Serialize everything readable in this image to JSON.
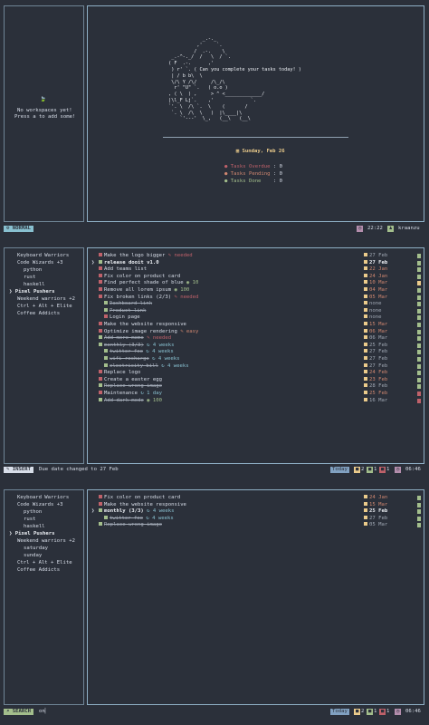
{
  "screen1": {
    "empty_icon": "🍃",
    "empty_line1": "No workspaces yet!",
    "empty_line2": "Press a to add some!",
    "ascii_art": "             _.-._\n           ,'     `.\n          /  .-.    \\\n  _.-^-._/  /   \\  / `.\n ( F  .-.      ,'\n  ) r' `. ( Can you complete your tasks today! )\n  | / b b\\  \\\n  \\/\\ Y /\\/     /\\_/\\\n   r' \"U\" `.   ( o.o )\n , ( \\  ) ,     > ^ <_____________/\n |\\l_F Lj`.    ,'             `.\n `'. \\  /\\ `.  \\    (       /\n  `. \\  /\\  \\   )  |\\____|\\\n     `'---'  \\_,   (__\\   (__\\",
    "speech": "( Can you complete your tasks today! )",
    "date": "Sunday, Feb 26",
    "stats": [
      {
        "label": "Tasks Overdue",
        "value": ": 0",
        "color": "#bf616a"
      },
      {
        "label": "Tasks Pending",
        "value": ": 0",
        "color": "#d08770"
      },
      {
        "label": "Tasks Done   ",
        "value": ": 0",
        "color": "#a3be8c"
      }
    ],
    "status": {
      "mode": "NORMAL",
      "time": "22:22",
      "user": "kraanzu"
    }
  },
  "screen2": {
    "workspaces": [
      {
        "label": "Keyboard Warriors",
        "indent": 0,
        "sel": false
      },
      {
        "label": "Code Wizards +3",
        "indent": 0,
        "sel": false
      },
      {
        "label": "python",
        "indent": 1,
        "sel": false
      },
      {
        "label": "rust",
        "indent": 1,
        "sel": false
      },
      {
        "label": "haskell",
        "indent": 1,
        "sel": false
      },
      {
        "label": "Pixel Pushers",
        "indent": 0,
        "sel": true
      },
      {
        "label": "Weekend warriors +2",
        "indent": 0,
        "sel": false
      },
      {
        "label": "Ctrl + Alt + Elite",
        "indent": 0,
        "sel": false
      },
      {
        "label": "Coffee Addicts",
        "indent": 0,
        "sel": false
      }
    ],
    "tasks": [
      {
        "text": "Make the logo bigger",
        "tag": "needed",
        "tc": "",
        "due": "27 Feb",
        "dc": "due-gray",
        "icon": "o",
        "st": "",
        "prio": "#a3be8c"
      },
      {
        "text": "release dooit v1.0",
        "tag": "",
        "tc": "",
        "due": "27 Feb",
        "dc": "due-strong",
        "icon": "g",
        "st": "bold",
        "prio": "#a3be8c"
      },
      {
        "text": "Add teams list",
        "tag": "",
        "tc": "",
        "due": "22 Jan",
        "dc": "due-red",
        "icon": "o",
        "st": "",
        "prio": "#a3be8c"
      },
      {
        "text": "Fix color on product card",
        "tag": "",
        "tc": "",
        "due": "24 Jan",
        "dc": "due-red",
        "icon": "o",
        "st": "",
        "prio": "#a3be8c"
      },
      {
        "text": "Find perfect shade of blue",
        "tag": "10",
        "tc": "b",
        "due": "10 Mar",
        "dc": "due-red",
        "icon": "o",
        "st": "",
        "prio": "#ebcb8b"
      },
      {
        "text": "Remove all lorem ipsum",
        "tag": "100",
        "tc": "b",
        "due": "04 Mar",
        "dc": "due-red",
        "icon": "o",
        "st": "",
        "prio": "#a3be8c"
      },
      {
        "text": "Fix broken links (2/3)",
        "tag": "needed",
        "tc": "",
        "due": "05 Mar",
        "dc": "due-red",
        "icon": "o",
        "st": "",
        "prio": "#a3be8c"
      },
      {
        "text": "  Dashboard link",
        "tag": "",
        "tc": "",
        "due": "none",
        "dc": "due-gray",
        "icon": "g",
        "st": "done",
        "prio": "#a3be8c"
      },
      {
        "text": "  Product link",
        "tag": "",
        "tc": "",
        "due": "none",
        "dc": "due-gray",
        "icon": "g",
        "st": "done",
        "prio": "#a3be8c"
      },
      {
        "text": "  Login page",
        "tag": "",
        "tc": "",
        "due": "none",
        "dc": "due-gray",
        "icon": "o",
        "st": "",
        "prio": "#a3be8c"
      },
      {
        "text": "Make the website responsive",
        "tag": "",
        "tc": "",
        "due": "15 Mar",
        "dc": "due-red",
        "icon": "o",
        "st": "",
        "prio": "#a3be8c"
      },
      {
        "text": "Optimize image rendering",
        "tag": "easy",
        "tc": "y",
        "due": "06 Mar",
        "dc": "due-red",
        "icon": "o",
        "st": "",
        "prio": "#a3be8c"
      },
      {
        "text": "Add more memo",
        "tag": "needed",
        "tc": "",
        "due": "06 Mar",
        "dc": "due-gray",
        "icon": "g",
        "st": "done",
        "prio": "#a3be8c"
      },
      {
        "text": "monthly (3/3)",
        "tag": "4 weeks",
        "tc": "g",
        "due": "25 Feb",
        "dc": "due-gray",
        "icon": "g",
        "st": "done",
        "prio": "#a3be8c"
      },
      {
        "text": "  twitter fee",
        "tag": "4 weeks",
        "tc": "g",
        "due": "27 Feb",
        "dc": "due-gray",
        "icon": "g",
        "st": "done",
        "prio": "#a3be8c"
      },
      {
        "text": "  wifi recharge",
        "tag": "4 weeks",
        "tc": "g",
        "due": "27 Feb",
        "dc": "due-gray",
        "icon": "g",
        "st": "done",
        "prio": "#a3be8c"
      },
      {
        "text": "  electricity bill",
        "tag": "4 weeks",
        "tc": "g",
        "due": "27 Feb",
        "dc": "due-gray",
        "icon": "g",
        "st": "done",
        "prio": "#a3be8c"
      },
      {
        "text": "Replace logo",
        "tag": "",
        "tc": "",
        "due": "24 Feb",
        "dc": "due-red",
        "icon": "o",
        "st": "",
        "prio": "#a3be8c"
      },
      {
        "text": "Create a easter egg",
        "tag": "",
        "tc": "",
        "due": "23 Feb",
        "dc": "due-red",
        "icon": "o",
        "st": "",
        "prio": "#a3be8c"
      },
      {
        "text": "Replace wrong image",
        "tag": "",
        "tc": "",
        "due": "28 Feb",
        "dc": "due-gray",
        "icon": "g",
        "st": "done",
        "prio": "#a3be8c"
      },
      {
        "text": "Maintenance",
        "tag": "1 day",
        "tc": "g",
        "due": "25 Feb",
        "dc": "due-red",
        "icon": "o",
        "st": "",
        "prio": "#bf616a"
      },
      {
        "text": "Add dark mode",
        "tag": "100",
        "tc": "b",
        "due": "16 Mar",
        "dc": "due-gray",
        "icon": "g",
        "st": "done",
        "prio": "#bf616a"
      }
    ],
    "status": {
      "mode": "INSERT",
      "message": "Due date changed to 27 Feb",
      "today": "Today",
      "c1": "2",
      "c2": "1",
      "c3": "1",
      "time": "06:46"
    }
  },
  "screen3": {
    "workspaces": [
      {
        "label": "Keyboard Warriors",
        "indent": 0,
        "sel": false
      },
      {
        "label": "Code Wizards +3",
        "indent": 0,
        "sel": false
      },
      {
        "label": "python",
        "indent": 1,
        "sel": false
      },
      {
        "label": "rust",
        "indent": 1,
        "sel": false
      },
      {
        "label": "haskell",
        "indent": 1,
        "sel": false
      },
      {
        "label": "Pixel Pushers",
        "indent": 0,
        "sel": true
      },
      {
        "label": "Weekend warriors +2",
        "indent": 0,
        "sel": false
      },
      {
        "label": "saturday",
        "indent": 1,
        "sel": false
      },
      {
        "label": "sunday",
        "indent": 1,
        "sel": false
      },
      {
        "label": "Ctrl + Alt + Elite",
        "indent": 0,
        "sel": false
      },
      {
        "label": "Coffee Addicts",
        "indent": 0,
        "sel": false
      }
    ],
    "tasks": [
      {
        "text": "Fix color on product card",
        "tag": "",
        "tc": "",
        "due": "24 Jan",
        "dc": "due-red",
        "icon": "o",
        "st": "",
        "prio": "#a3be8c"
      },
      {
        "text": "Make the website responsive",
        "tag": "",
        "tc": "",
        "due": "15 Mar",
        "dc": "due-red",
        "icon": "o",
        "st": "",
        "prio": "#a3be8c"
      },
      {
        "text": "monthly (3/3)",
        "tag": "4 weeks",
        "tc": "g",
        "due": "25 Feb",
        "dc": "due-strong",
        "icon": "g",
        "st": "bold",
        "prio": "#a3be8c"
      },
      {
        "text": "  twitter fee",
        "tag": "4 weeks",
        "tc": "g",
        "due": "27 Feb",
        "dc": "due-gray",
        "icon": "g",
        "st": "done",
        "prio": "#a3be8c"
      },
      {
        "text": "Replace wrong image",
        "tag": "",
        "tc": "",
        "due": "05 Mar",
        "dc": "due-gray",
        "icon": "g",
        "st": "done",
        "prio": "#a3be8c"
      }
    ],
    "status": {
      "mode": "SEARCH",
      "query": "on",
      "today": "Today",
      "c1": "2",
      "c2": "1",
      "c3": "1",
      "time": "06:46"
    }
  }
}
